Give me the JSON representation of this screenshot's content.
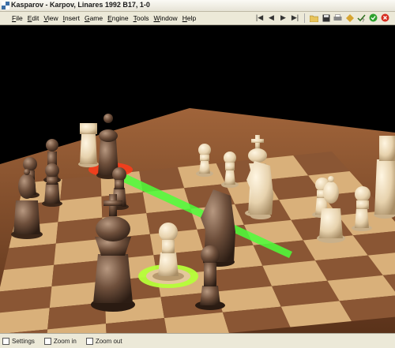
{
  "window": {
    "title": "Kasparov - Karpov, Linares 1992  B17, 1-0"
  },
  "menu": {
    "items": [
      {
        "key": "F",
        "rest": "ile"
      },
      {
        "key": "E",
        "rest": "dit"
      },
      {
        "key": "V",
        "rest": "iew"
      },
      {
        "key": "I",
        "rest": "nsert"
      },
      {
        "key": "G",
        "rest": "ame"
      },
      {
        "key": "E",
        "rest": "ngine"
      },
      {
        "key": "T",
        "rest": "ools"
      },
      {
        "key": "W",
        "rest": "indow"
      },
      {
        "key": "H",
        "rest": "elp"
      }
    ]
  },
  "toolbar": {
    "icons": [
      "first-move-icon",
      "previous-move-icon",
      "next-move-icon",
      "last-move-icon",
      "open-icon",
      "save-icon",
      "print-icon",
      "analysis-icon",
      "help-icon",
      "ok-icon",
      "close-icon"
    ]
  },
  "colors": {
    "board_light": "#d9b07a",
    "board_dark": "#8a5634",
    "arrow": "#4cff3a",
    "highlight_red": "#ff3b1a",
    "highlight_green": "#b6ff3a"
  },
  "statusbar": {
    "settings": "Settings",
    "zoom_in": "Zoom in",
    "zoom_out": "Zoom out"
  }
}
